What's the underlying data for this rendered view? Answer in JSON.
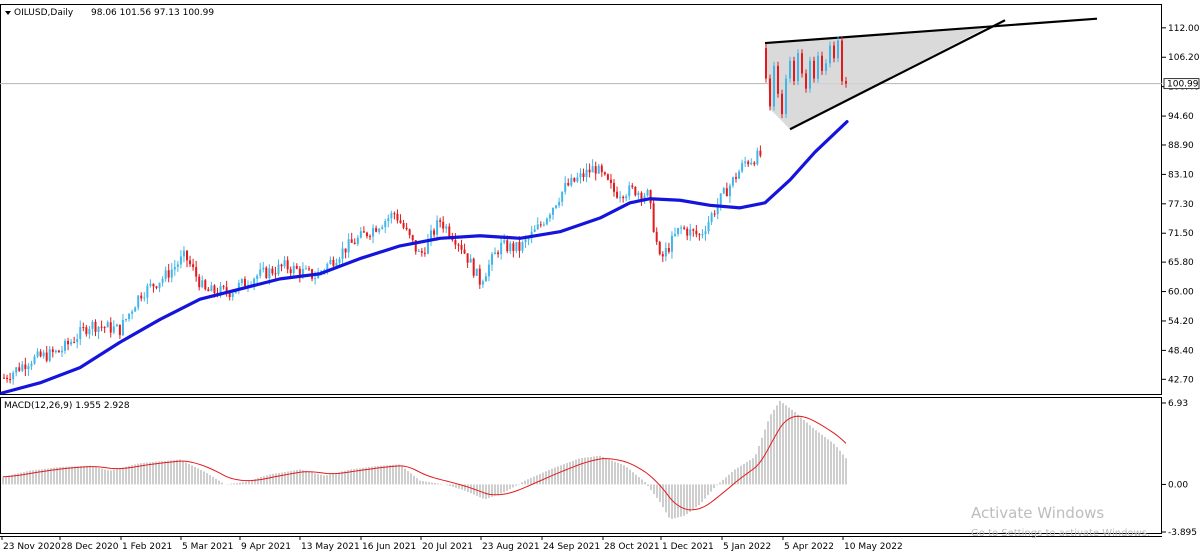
{
  "header": {
    "symbol": "OILUSD,Daily",
    "ohlc": "98.06 101.56 97.13 100.99",
    "macd_label": "MACD(12,26,9) 1.955 2.928"
  },
  "watermark": {
    "title": "Activate Windows",
    "subtitle": "Go to Settings to activate Windows."
  },
  "chart_data": {
    "type": "candlestick",
    "price_panel": {
      "ylim": [
        39.8,
        116.5
      ],
      "y_ticks": [
        "112.00",
        "106.20",
        "100.40",
        "94.60",
        "88.90",
        "83.10",
        "77.30",
        "71.50",
        "65.80",
        "60.00",
        "54.20",
        "48.40",
        "42.70"
      ],
      "last_price": "100.99",
      "last_price_value": 100.99,
      "ma_start": 40.0,
      "ma_end": 93.5,
      "pennant": {
        "upper": [
          [
            0,
            109.0
          ],
          [
            1,
            113.8
          ]
        ],
        "lower": [
          [
            0,
            92.0
          ],
          [
            1,
            101.5
          ]
        ]
      }
    },
    "macd_panel": {
      "ylim": [
        -3.895,
        6.93
      ],
      "y_ticks": [
        "6.93",
        "0.00",
        "-3.895"
      ]
    },
    "x_labels": [
      "23 Nov 2020",
      "28 Dec 2020",
      "1 Feb 2021",
      "5 Mar 2021",
      "9 Apr 2021",
      "13 May 2021",
      "16 Jun 2021",
      "20 Jul 2021",
      "23 Aug 2021",
      "24 Sep 2021",
      "28 Oct 2021",
      "1 Dec 2021",
      "5 Jan 2022",
      "5 Apr 2022",
      "10 May 2022"
    ],
    "colors": {
      "up": "#42b6e8",
      "down": "#e31a1c",
      "ma": "#1414dc",
      "signal": "#e31a1c",
      "histogram": "#c8c8c8",
      "pennant_fill": "#d3d3d3"
    }
  }
}
